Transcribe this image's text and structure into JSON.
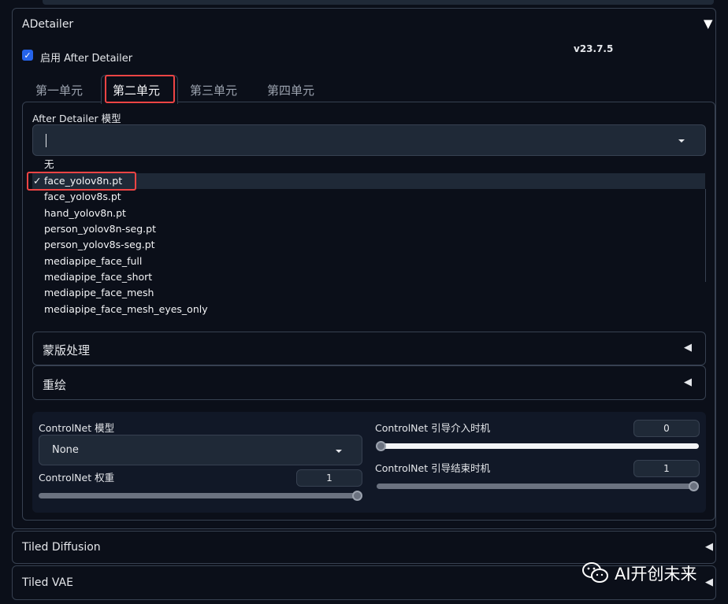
{
  "adetailer": {
    "title": "ADetailer",
    "version": "v23.7.5",
    "enable_label": "启用 After Detailer",
    "enabled": true,
    "tabs": [
      "第一单元",
      "第二单元",
      "第三单元",
      "第四单元"
    ],
    "active_tab": 1,
    "model_label": "After Detailer 模型",
    "model_options": [
      "无",
      "face_yolov8n.pt",
      "face_yolov8s.pt",
      "hand_yolov8n.pt",
      "person_yolov8n-seg.pt",
      "person_yolov8s-seg.pt",
      "mediapipe_face_full",
      "mediapipe_face_short",
      "mediapipe_face_mesh",
      "mediapipe_face_mesh_eyes_only"
    ],
    "selected_model": "face_yolov8n.pt",
    "check_mark": "✓",
    "sections": [
      {
        "label": "蒙版处理",
        "arrow": "◀"
      },
      {
        "label": "重绘",
        "arrow": "◀"
      }
    ],
    "controlnet": {
      "model_label": "ControlNet 模型",
      "model_value": "None",
      "weight_label": "ControlNet 权重",
      "weight_value": "1",
      "guidance_start_label": "ControlNet 引导介入时机",
      "guidance_start_value": "0",
      "guidance_end_label": "ControlNet 引导结束时机",
      "guidance_end_value": "1"
    }
  },
  "collapsed_sections": [
    {
      "label": "Tiled Diffusion",
      "arrow": "◀"
    },
    {
      "label": "Tiled VAE",
      "arrow": "◀"
    }
  ],
  "watermark": "AI开创未来",
  "icons": {
    "collapse": "▼",
    "expand": "◀"
  },
  "colors": {
    "background": "#0b0f19",
    "panel": "#111827",
    "input": "#1f2937",
    "accent": "#2563eb",
    "highlight": "#ef4444"
  }
}
